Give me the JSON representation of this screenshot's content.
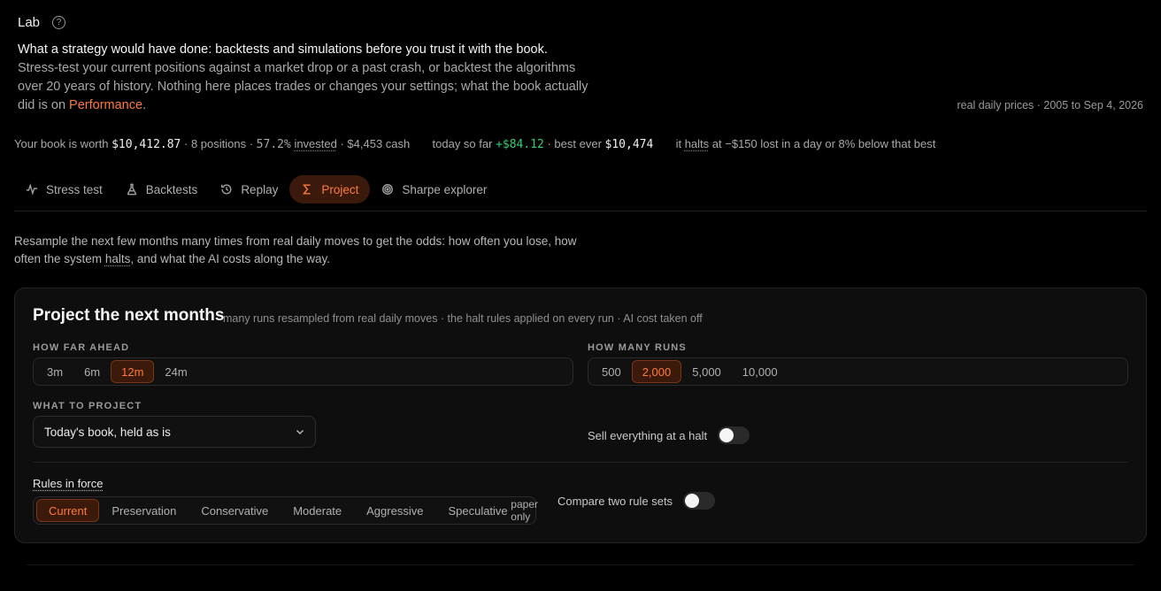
{
  "header": {
    "title": "Lab",
    "help_glyph": "?"
  },
  "intro": {
    "lead": "What a strategy would have done: backtests and simulations before you trust it with the book.",
    "body": "Stress-test your current positions against a market drop or a past crash, or backtest the algorithms over 20 years of history. Nothing here places trades or changes your settings; what the book actually did is on ",
    "link": "Performance",
    "end": "."
  },
  "data_range": "real daily prices · 2005 to Sep 4, 2026",
  "status": {
    "worth_label": "Your book is worth",
    "worth_value": "$10,412.87",
    "sep1": " · ",
    "positions": "8 positions",
    "sep2": " · ",
    "invested_pct": "57.2%",
    "invested_word": "invested",
    "sep3": " · ",
    "cash": "$4,453 cash",
    "today_label": "today so far",
    "today_value": "+$84.12",
    "best_label": " · best ever",
    "best_value": "$10,474",
    "halt_pre": "it",
    "halt_word": "halts",
    "halt_post": "at −$150 lost in a day or 8% below that best"
  },
  "tabs": [
    {
      "label": "Stress test",
      "icon": "pulse-icon"
    },
    {
      "label": "Backtests",
      "icon": "flask-icon"
    },
    {
      "label": "Replay",
      "icon": "history-icon"
    },
    {
      "label": "Project",
      "icon": "sigma-icon",
      "active": true
    },
    {
      "label": "Sharpe explorer",
      "icon": "target-icon"
    }
  ],
  "description": {
    "pre": "Resample the next few months many times from real daily moves to get the odds: how often you lose, how often the system",
    "halts": "halts",
    "post": ", and what the AI costs along the way."
  },
  "card": {
    "title": "Project the next months",
    "subtitle": "many runs resampled from real daily moves · the halt rules applied on every run · AI cost taken off",
    "horizon": {
      "label": "HOW FAR AHEAD",
      "options": [
        "3m",
        "6m",
        "12m",
        "24m"
      ],
      "selected": "12m"
    },
    "runs": {
      "label": "HOW MANY RUNS",
      "options": [
        "500",
        "2,000",
        "5,000",
        "10,000"
      ],
      "selected": "2,000"
    },
    "project": {
      "label": "WHAT TO PROJECT",
      "value": "Today's book, held as is"
    },
    "sell_toggle": {
      "label": "Sell everything at a halt",
      "on": false
    },
    "rules": {
      "label": "Rules in force",
      "options": [
        "Current",
        "Preservation",
        "Conservative",
        "Moderate",
        "Aggressive"
      ],
      "speculative": "Speculative",
      "speculative_note": "paper only",
      "selected": "Current"
    },
    "compare_toggle": {
      "label": "Compare two rule sets",
      "on": false
    }
  },
  "colors": {
    "accent": "#ff7a3d",
    "accent_bg": "#3b1a0c",
    "gain": "#2fcf6f"
  }
}
